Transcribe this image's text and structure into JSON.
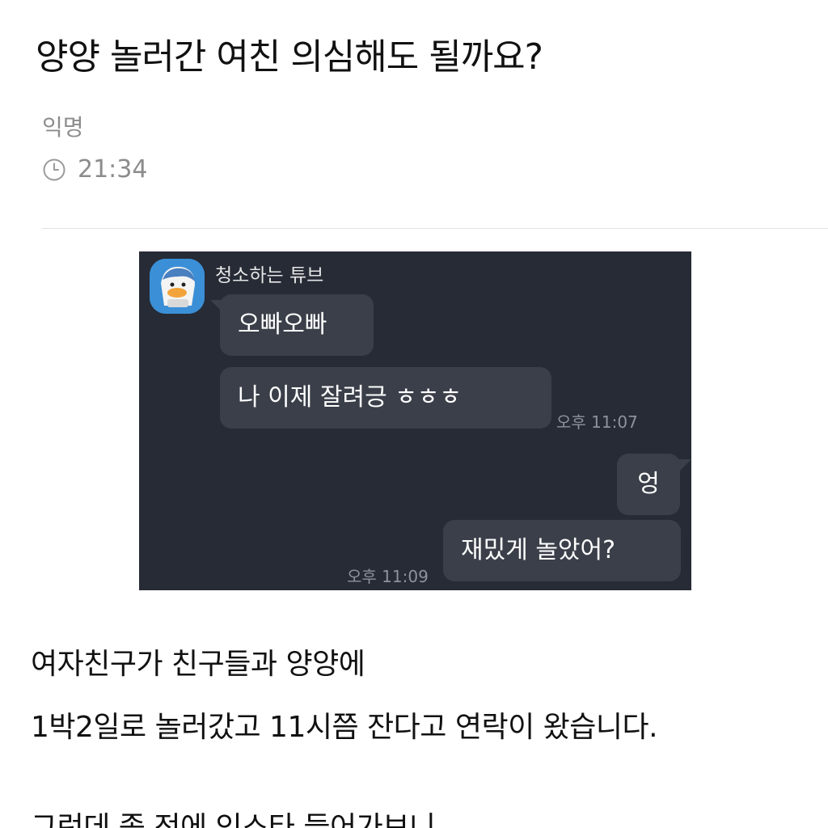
{
  "post": {
    "title": "양양 놀러간 여친 의심해도 될까요?",
    "author": "익명",
    "time": "21:34",
    "time_icon": "clock-icon"
  },
  "chat": {
    "sender_name": "청소하는 튜브",
    "avatar_icon": "duck-character-avatar",
    "messages": [
      {
        "side": "left",
        "text": "오빠오빠"
      },
      {
        "side": "left",
        "text": "나 이제 잘려긍 ㅎㅎㅎ",
        "time": "오후 11:07"
      },
      {
        "side": "right",
        "text": "엉"
      },
      {
        "side": "right",
        "text": "재밌게 놀았어?",
        "time": "오후 11:09"
      }
    ],
    "colors": {
      "background": "#262b36",
      "bubble": "#3a3f49",
      "avatar_bg": "#3b8fd6"
    }
  },
  "body": {
    "paragraphs": [
      "여자친구가 친구들과 양양에",
      "1박2일로 놀러갔고 11시쯤 잔다고 연락이 왔습니다.",
      "그런데 좀 전에 인스타 들어가보니"
    ]
  }
}
